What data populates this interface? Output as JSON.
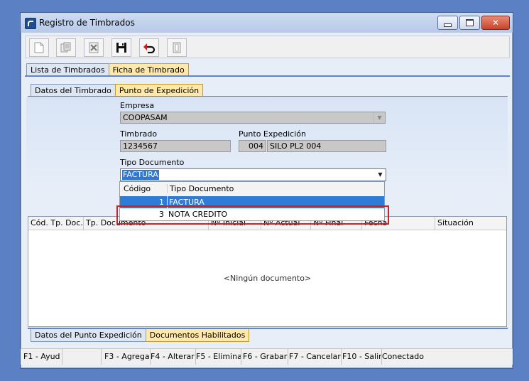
{
  "window": {
    "title": "Registro de Timbrados"
  },
  "toolbar": {
    "buttons": [
      {
        "name": "new-icon"
      },
      {
        "name": "copy-icon"
      },
      {
        "name": "delete-icon"
      },
      {
        "name": "save-icon"
      },
      {
        "name": "undo-icon"
      },
      {
        "name": "exit-icon"
      }
    ]
  },
  "outer_tabs": [
    "Lista de Timbrados",
    "Ficha de Timbrado"
  ],
  "inner_tabs": [
    "Datos del Timbrado",
    "Punto de Expedición"
  ],
  "form": {
    "empresa_label": "Empresa",
    "empresa_value": "COOPASAM",
    "timbrado_label": "Timbrado",
    "timbrado_value": "1234567",
    "punto_label": "Punto Expedición",
    "punto_code": "004",
    "punto_desc": "SILO PL2 004",
    "tipo_label": "Tipo Documento",
    "tipo_value": "FACTURA"
  },
  "dropdown": {
    "headers": [
      "Código",
      "Tipo Documento"
    ],
    "rows": [
      {
        "code": "1",
        "desc": "FACTURA"
      },
      {
        "code": "3",
        "desc": "NOTA CREDITO"
      }
    ]
  },
  "grid": {
    "headers": [
      "Cód. Tp. Doc.",
      "Tp. Documento",
      "Nº Inicial",
      "Nº Actual",
      "Nº Final",
      "Fecha",
      "Situación"
    ],
    "empty_text": "<Ningún documento>"
  },
  "bottom_tabs": [
    "Datos del Punto Expedición",
    "Documentos Habilitados"
  ],
  "status": [
    "F1 - Ayud",
    "",
    "F3 - Agrega",
    "F4 - Alterar",
    "F5 - Elimina",
    "F6 - Grabar",
    "F7 - Cancelar",
    "F10 - Salir",
    "Conectado"
  ],
  "colors": {
    "accent": "#3178d4",
    "active_tab": "#ffe8a8",
    "highlight_box": "#c4262e"
  }
}
